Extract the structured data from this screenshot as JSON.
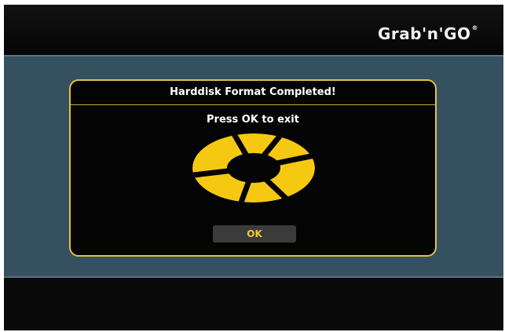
{
  "header": {
    "brand_name": "Grab'n'GO",
    "brand_mark": "®"
  },
  "dialog": {
    "title": "Harddisk Format Completed!",
    "message": "Press OK to exit",
    "ok_label": "OK",
    "spinner_icon": "busy-spinner-icon"
  },
  "colors": {
    "accent": "#f1cc2b",
    "dialog_border": "#e2c341",
    "stage_background": "#35505f",
    "screen_background": "#0b0b0b"
  }
}
